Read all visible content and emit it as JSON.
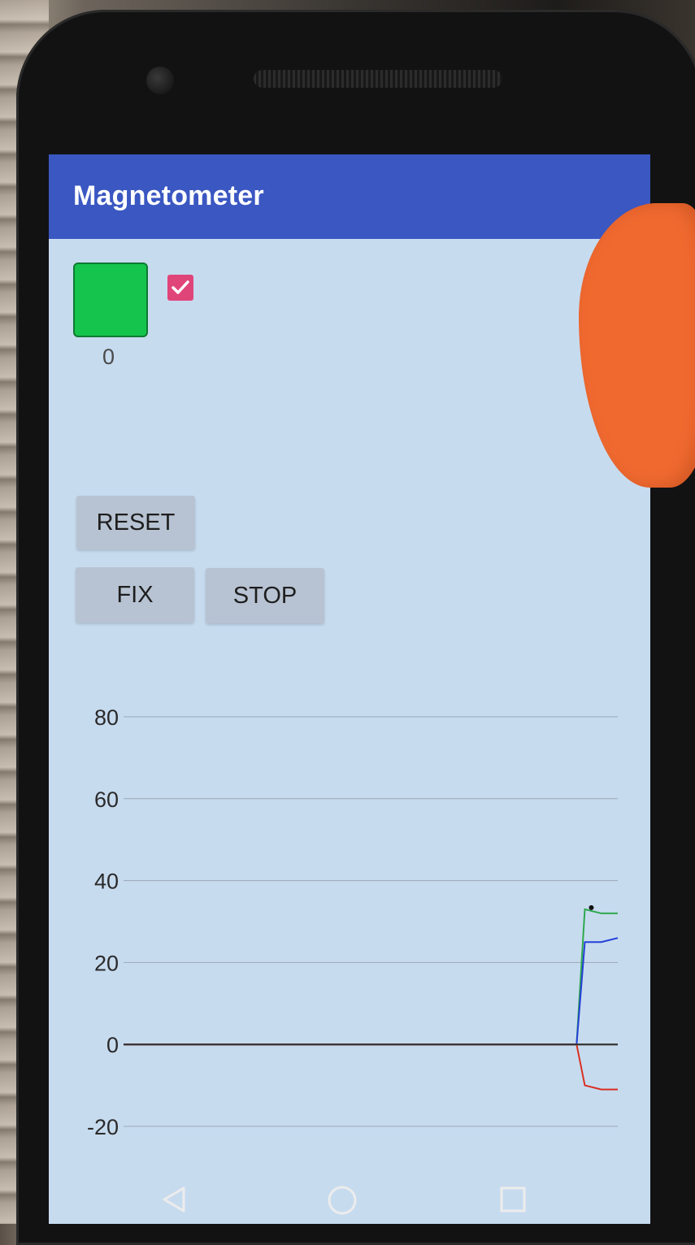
{
  "app": {
    "title": "Magnetometer"
  },
  "status": {
    "indicator_color": "#14c44c",
    "count": "0",
    "checkbox_checked": true
  },
  "buttons": {
    "reset_label": "RESET",
    "fix_label": "FIX",
    "stop_label": "STOP"
  },
  "icons": {
    "checkbox": "check-icon",
    "back": "back-triangle-icon",
    "home": "home-circle-icon",
    "recents": "recents-square-icon"
  },
  "chart_data": {
    "type": "line",
    "title": "",
    "xlabel": "",
    "ylabel": "",
    "ylim": [
      -20,
      80
    ],
    "yticks": [
      "80",
      "60",
      "40",
      "20",
      "0",
      "-20"
    ],
    "grid": true,
    "legend": "none",
    "x": [
      0,
      55,
      56,
      58,
      60
    ],
    "series": [
      {
        "color": "#2fa84f",
        "values": [
          0,
          0,
          33,
          32,
          32
        ]
      },
      {
        "color": "#2340d8",
        "values": [
          0,
          0,
          25,
          25,
          26
        ]
      },
      {
        "color": "#d83020",
        "values": [
          0,
          0,
          -10,
          -11,
          -11
        ]
      },
      {
        "color": "#333333",
        "values": [
          0,
          0,
          0,
          0,
          0
        ]
      }
    ]
  }
}
